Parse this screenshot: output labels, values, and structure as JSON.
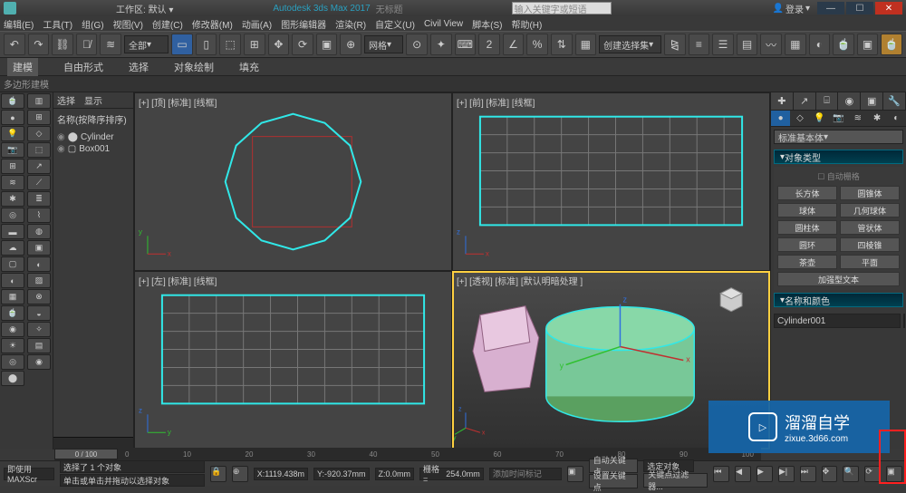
{
  "titlebar": {
    "workspace_prefix": "工作区:",
    "workspace": "默认",
    "app": "Autodesk 3ds Max 2017",
    "file": "无标题",
    "search_placeholder": "输入关键字或短语",
    "login": "登录"
  },
  "menu": [
    "编辑(E)",
    "工具(T)",
    "组(G)",
    "视图(V)",
    "创建(C)",
    "修改器(M)",
    "动画(A)",
    "图形编辑器",
    "渲染(R)",
    "自定义(U)",
    "Civil View",
    "脚本(S)",
    "帮助(H)"
  ],
  "toolbar": {
    "dropdown1": "全部",
    "snap": "网格",
    "create_set": "创建选择集"
  },
  "ribbon": {
    "tabs": [
      "建模",
      "自由形式",
      "选择",
      "对象绘制",
      "填充"
    ],
    "sub": "多边形建模"
  },
  "scene": {
    "tabs": [
      "选择",
      "显示"
    ],
    "title": "名称(按降序排序)",
    "items": [
      "Cylinder",
      "Box001"
    ]
  },
  "viewports": {
    "top": "[+] [顶] [标准] [线框]",
    "front": "[+] [前] [标准] [线框]",
    "left": "[+] [左] [标准] [线框]",
    "persp": "[+] [透视] [标准] [默认明暗处理 ]"
  },
  "cmd": {
    "dropdown": "标准基本体",
    "rollout1": "对象类型",
    "autogrid": "自动栅格",
    "buttons": [
      "长方体",
      "圆锥体",
      "球体",
      "几何球体",
      "圆柱体",
      "管状体",
      "圆环",
      "四棱锥",
      "茶壶",
      "平面",
      "加强型文本",
      ""
    ],
    "rollout2": "名称和颜色",
    "objname": "Cylinder001"
  },
  "timeline": {
    "slider": "0 / 100",
    "ticks": [
      "0",
      "10",
      "20",
      "30",
      "40",
      "50",
      "60",
      "70",
      "80",
      "90",
      "100"
    ],
    "keymark": "添加时间标记"
  },
  "status": {
    "selected": "选择了 1 个对象",
    "hint": "单击或单击并拖动以选择对象",
    "maxscript": "即使用 MAXScr",
    "x_label": "X:",
    "x": "1119.438m",
    "y_label": "Y:",
    "y": "-920.37mm",
    "z_label": "Z:",
    "z": "0.0mm",
    "grid_label": "栅格 =",
    "grid": "254.0mm",
    "autokey": "自动关键点",
    "setkey": "设置关键点",
    "keyopts": "选定对象",
    "keyfilter": "关键点过滤器..."
  },
  "watermark": {
    "brand": "溜溜自学",
    "url": "zixue.3d66.com"
  }
}
